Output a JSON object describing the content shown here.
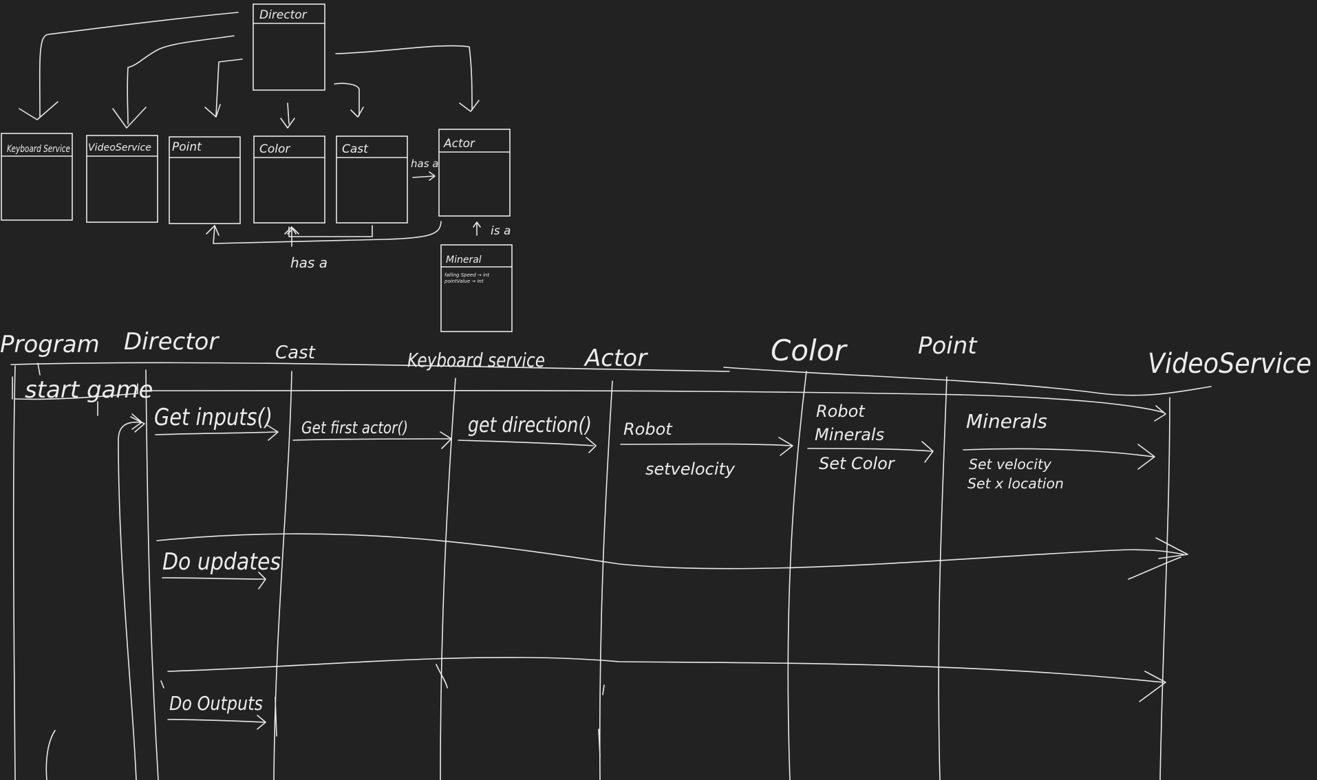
{
  "class_diagram": {
    "director_box": {
      "title": "Director"
    },
    "boxes": {
      "keyboard": "Keyboard Service",
      "video": "VideoService",
      "point": "Point",
      "color": "Color",
      "cast": "Cast",
      "actor": "Actor",
      "mineral": "Mineral"
    },
    "mineral_attributes": [
      "falling Speed → int",
      "pointValue → int"
    ],
    "relations": {
      "has_a_cast_actor": "has a",
      "is_a": "is a",
      "has_a_bottom": "has a"
    }
  },
  "sequence_diagram": {
    "lifelines": {
      "program": "Program",
      "director": "Director",
      "cast": "Cast",
      "keyboard": "Keyboard service",
      "actor": "Actor",
      "color": "Color",
      "point": "Point",
      "video": "VideoService"
    },
    "messages": {
      "start_game": "start game",
      "get_inputs": "Get inputs()",
      "get_first_actor": "Get first actor()",
      "get_direction": "get direction()",
      "robot": "Robot",
      "set_velocity": "setvelocity",
      "robot_minerals": [
        "Robot",
        "Minerals"
      ],
      "set_color": "Set Color",
      "minerals": "Minerals",
      "set_velocity_location": [
        "Set velocity",
        "Set x location"
      ],
      "do_updates": "Do updates",
      "do_outputs": "Do Outputs"
    }
  },
  "colors": {
    "background": "#222222",
    "ink": "#e9e9e9"
  }
}
